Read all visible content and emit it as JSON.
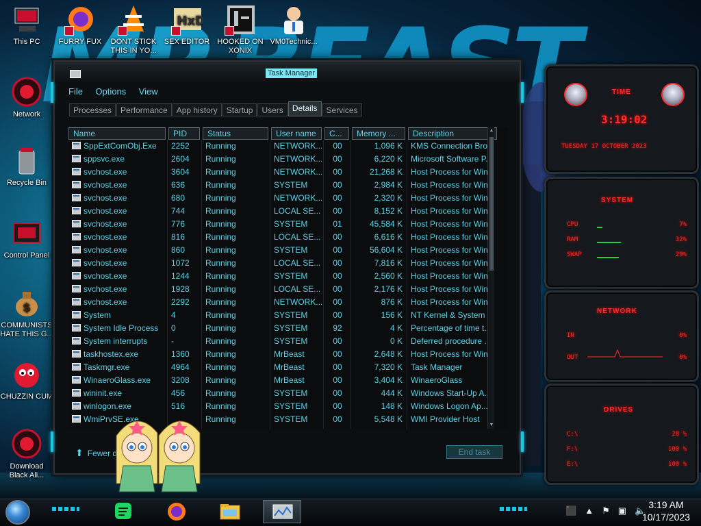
{
  "desktop": {
    "icons": [
      {
        "label": "This PC"
      },
      {
        "label": "FURRY FUX"
      },
      {
        "label": "DONT STICK THIS IN YO..."
      },
      {
        "label": "SEX EDITOR"
      },
      {
        "label": "HOOKED ON XONIX"
      },
      {
        "label": "VM0Technic..."
      },
      {
        "label": "Network"
      },
      {
        "label": "Recycle Bin"
      },
      {
        "label": "Control Panel"
      },
      {
        "label": "COMMUNISTS HATE THIS G..."
      },
      {
        "label": "CHUZZIN CUM"
      },
      {
        "label": "Download Black Ali..."
      }
    ]
  },
  "task_manager": {
    "title": "Task Manager",
    "menu": [
      "File",
      "Options",
      "View"
    ],
    "tabs": [
      "Processes",
      "Performance",
      "App history",
      "Startup",
      "Users",
      "Details",
      "Services"
    ],
    "active_tab": "Details",
    "columns": [
      "Name",
      "PID",
      "Status",
      "User name",
      "C...",
      "Memory ...",
      "Description"
    ],
    "rows": [
      [
        "SppExtComObj.Exe",
        "2252",
        "Running",
        "NETWORK...",
        "00",
        "1,096 K",
        "KMS Connection Bro..."
      ],
      [
        "sppsvc.exe",
        "2604",
        "Running",
        "NETWORK...",
        "00",
        "6,220 K",
        "Microsoft Software P..."
      ],
      [
        "svchost.exe",
        "3604",
        "Running",
        "NETWORK...",
        "00",
        "21,268 K",
        "Host Process for Win..."
      ],
      [
        "svchost.exe",
        "636",
        "Running",
        "SYSTEM",
        "00",
        "2,984 K",
        "Host Process for Win..."
      ],
      [
        "svchost.exe",
        "680",
        "Running",
        "NETWORK...",
        "00",
        "2,320 K",
        "Host Process for Win..."
      ],
      [
        "svchost.exe",
        "744",
        "Running",
        "LOCAL SE...",
        "00",
        "8,152 K",
        "Host Process for Win..."
      ],
      [
        "svchost.exe",
        "776",
        "Running",
        "SYSTEM",
        "01",
        "45,584 K",
        "Host Process for Win..."
      ],
      [
        "svchost.exe",
        "816",
        "Running",
        "LOCAL SE...",
        "00",
        "6,616 K",
        "Host Process for Win..."
      ],
      [
        "svchost.exe",
        "860",
        "Running",
        "SYSTEM",
        "00",
        "56,604 K",
        "Host Process for Win..."
      ],
      [
        "svchost.exe",
        "1072",
        "Running",
        "LOCAL SE...",
        "00",
        "7,816 K",
        "Host Process for Win..."
      ],
      [
        "svchost.exe",
        "1244",
        "Running",
        "SYSTEM",
        "00",
        "2,560 K",
        "Host Process for Win..."
      ],
      [
        "svchost.exe",
        "1928",
        "Running",
        "LOCAL SE...",
        "00",
        "2,176 K",
        "Host Process for Win..."
      ],
      [
        "svchost.exe",
        "2292",
        "Running",
        "NETWORK...",
        "00",
        "876 K",
        "Host Process for Win..."
      ],
      [
        "System",
        "4",
        "Running",
        "SYSTEM",
        "00",
        "156 K",
        "NT Kernel & System"
      ],
      [
        "System Idle Process",
        "0",
        "Running",
        "SYSTEM",
        "92",
        "4 K",
        "Percentage of time t..."
      ],
      [
        "System interrupts",
        "-",
        "Running",
        "SYSTEM",
        "00",
        "0 K",
        "Deferred procedure ..."
      ],
      [
        "taskhostex.exe",
        "1360",
        "Running",
        "MrBeast",
        "00",
        "2,648 K",
        "Host Process for Win..."
      ],
      [
        "Taskmgr.exe",
        "4964",
        "Running",
        "MrBeast",
        "00",
        "7,320 K",
        "Task Manager"
      ],
      [
        "WinaeroGlass.exe",
        "3208",
        "Running",
        "MrBeast",
        "00",
        "3,404 K",
        "WinaeroGlass"
      ],
      [
        "wininit.exe",
        "456",
        "Running",
        "SYSTEM",
        "00",
        "444 K",
        "Windows Start-Up A..."
      ],
      [
        "winlogon.exe",
        "516",
        "Running",
        "SYSTEM",
        "00",
        "148 K",
        "Windows Logon Ap..."
      ],
      [
        "WmiPrvSE.exe",
        "",
        "Running",
        "SYSTEM",
        "00",
        "5,548 K",
        "WMI Provider Host"
      ]
    ],
    "fewer_details": "Fewer details",
    "end_task": "End task"
  },
  "gadgets": {
    "clock": {
      "title": "TIME",
      "time": "3:19:02",
      "date": "TUESDAY 17 OCTOBER 2023"
    },
    "system": {
      "title": "SYSTEM",
      "rows": [
        {
          "key": "CPU",
          "value": "7%",
          "level": 0.07
        },
        {
          "key": "RAM",
          "value": "32%",
          "level": 0.32
        },
        {
          "key": "SWAP",
          "value": "29%",
          "level": 0.29
        }
      ]
    },
    "network": {
      "title": "NETWORK",
      "rows": [
        {
          "key": "IN",
          "value": "0%"
        },
        {
          "key": "OUT",
          "value": "0%"
        }
      ]
    },
    "drives": {
      "title": "DRIVES",
      "rows": [
        {
          "key": "C:\\",
          "value": "28 %"
        },
        {
          "key": "F:\\",
          "value": "100 %"
        },
        {
          "key": "E:\\",
          "value": "100 %"
        }
      ]
    }
  },
  "taskbar": {
    "time": "3:19 AM",
    "date": "10/17/2023"
  },
  "colors": {
    "accent_cyan": "#18c6e6",
    "text_cyan": "#5fd2e6",
    "gadget_red": "#ff2a2a"
  }
}
